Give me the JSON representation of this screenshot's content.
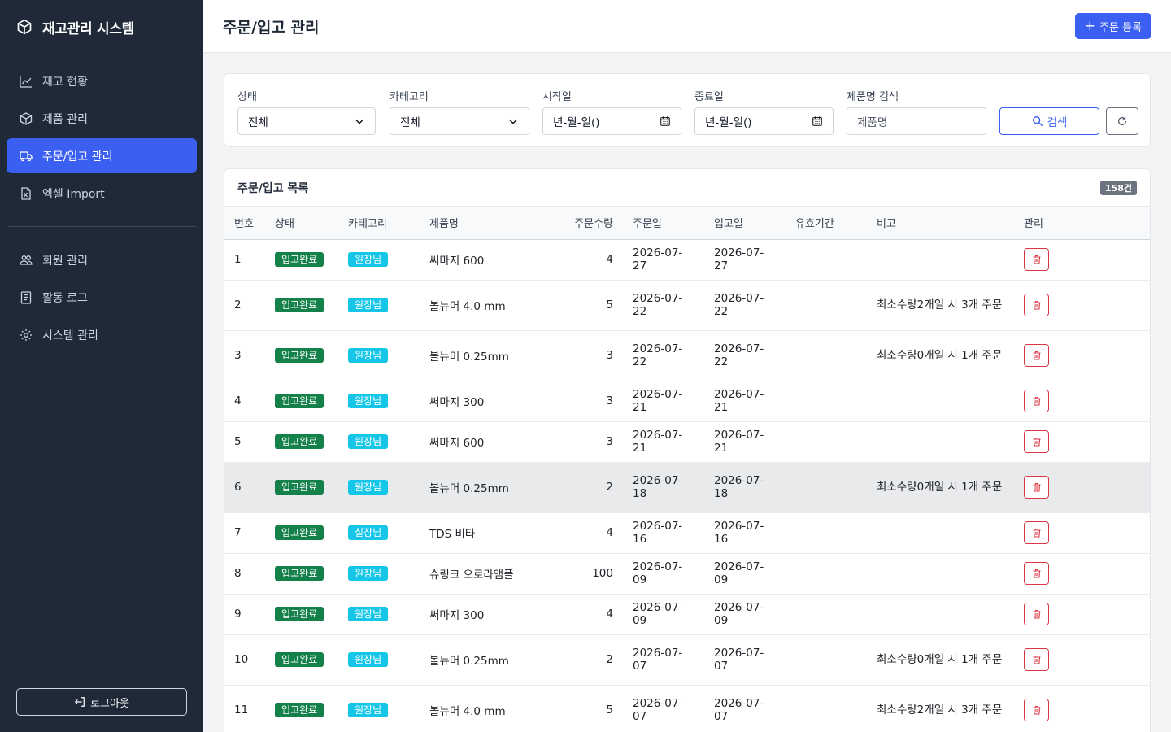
{
  "app": {
    "title": "재고관리 시스템"
  },
  "sidebar": {
    "items": [
      {
        "label": "재고 현황",
        "icon": "chart-line-icon"
      },
      {
        "label": "제품 관리",
        "icon": "box-icon"
      },
      {
        "label": "주문/입고 관리",
        "icon": "truck-icon",
        "active": true
      },
      {
        "label": "엑셀 Import",
        "icon": "excel-file-icon"
      }
    ],
    "items2": [
      {
        "label": "회원 관리",
        "icon": "people-icon"
      },
      {
        "label": "활동 로그",
        "icon": "log-icon"
      },
      {
        "label": "시스템 관리",
        "icon": "gear-icon"
      }
    ],
    "logout_label": "로그아웃"
  },
  "header": {
    "title": "주문/입고 관리",
    "add_button": "주문 등록"
  },
  "filters": {
    "status_label": "상태",
    "status_value": "전체",
    "category_label": "카테고리",
    "category_value": "전체",
    "start_label": "시작일",
    "start_value": "년-월-일()",
    "end_label": "종료일",
    "end_value": "년-월-일()",
    "search_label": "제품명 검색",
    "search_placeholder": "제품명",
    "search_button": "검색"
  },
  "list": {
    "title": "주문/입고 목록",
    "count": "158건",
    "columns": [
      "번호",
      "상태",
      "카테고리",
      "제품명",
      "주문수량",
      "주문일",
      "입고일",
      "유효기간",
      "비고",
      "관리"
    ],
    "rows": [
      {
        "no": "1",
        "status": "입고완료",
        "category": "원장님",
        "product": "써마지 600",
        "qty": "4",
        "order_date": "2026-07-27",
        "receive_date": "2026-07-27",
        "expiry": "",
        "note": ""
      },
      {
        "no": "2",
        "status": "입고완료",
        "category": "원장님",
        "product": "볼뉴머 4.0 mm",
        "qty": "5",
        "order_date": "2026-07-22",
        "receive_date": "2026-07-22",
        "expiry": "",
        "note": "최소수량2개일 시 3개 주문"
      },
      {
        "no": "3",
        "status": "입고완료",
        "category": "원장님",
        "product": "볼뉴머 0.25mm",
        "qty": "3",
        "order_date": "2026-07-22",
        "receive_date": "2026-07-22",
        "expiry": "",
        "note": "최소수량0개일 시 1개 주문"
      },
      {
        "no": "4",
        "status": "입고완료",
        "category": "원장님",
        "product": "써마지 300",
        "qty": "3",
        "order_date": "2026-07-21",
        "receive_date": "2026-07-21",
        "expiry": "",
        "note": ""
      },
      {
        "no": "5",
        "status": "입고완료",
        "category": "원장님",
        "product": "써마지 600",
        "qty": "3",
        "order_date": "2026-07-21",
        "receive_date": "2026-07-21",
        "expiry": "",
        "note": ""
      },
      {
        "no": "6",
        "status": "입고완료",
        "category": "원장님",
        "product": "볼뉴머 0.25mm",
        "qty": "2",
        "order_date": "2026-07-18",
        "receive_date": "2026-07-18",
        "expiry": "",
        "note": "최소수량0개일 시 1개 주문"
      },
      {
        "no": "7",
        "status": "입고완료",
        "category": "실장님",
        "product": "TDS 비타",
        "qty": "4",
        "order_date": "2026-07-16",
        "receive_date": "2026-07-16",
        "expiry": "",
        "note": ""
      },
      {
        "no": "8",
        "status": "입고완료",
        "category": "원장님",
        "product": "슈링크 오로라앰플",
        "qty": "100",
        "order_date": "2026-07-09",
        "receive_date": "2026-07-09",
        "expiry": "",
        "note": ""
      },
      {
        "no": "9",
        "status": "입고완료",
        "category": "원장님",
        "product": "써마지 300",
        "qty": "4",
        "order_date": "2026-07-09",
        "receive_date": "2026-07-09",
        "expiry": "",
        "note": ""
      },
      {
        "no": "10",
        "status": "입고완료",
        "category": "원장님",
        "product": "볼뉴머 0.25mm",
        "qty": "2",
        "order_date": "2026-07-07",
        "receive_date": "2026-07-07",
        "expiry": "",
        "note": "최소수량0개일 시 1개 주문"
      },
      {
        "no": "11",
        "status": "입고완료",
        "category": "원장님",
        "product": "볼뉴머 4.0 mm",
        "qty": "5",
        "order_date": "2026-07-07",
        "receive_date": "2026-07-07",
        "expiry": "",
        "note": "최소수량2개일 시 3개 주문"
      }
    ]
  },
  "colors": {
    "sidebar_bg": "#1f2937",
    "accent": "#3b5ff0",
    "status_green": "#14804a",
    "category_cyan": "#16c6e8",
    "danger": "#dc3545"
  }
}
